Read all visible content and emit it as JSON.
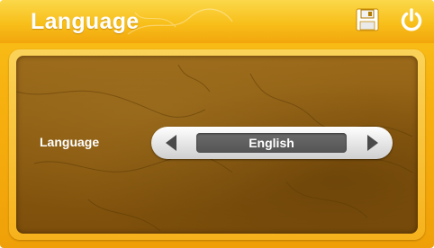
{
  "header": {
    "title": "Language",
    "save_icon": "save-icon",
    "power_icon": "power-icon"
  },
  "settings": {
    "language_label": "Language",
    "language_value": "English",
    "prev_icon": "triangle-left-icon",
    "next_icon": "triangle-right-icon"
  },
  "colors": {
    "accent": "#f7b10f",
    "panel_background": "#8a5a10",
    "selector_field": "#5e5e5e",
    "text": "#ffffff"
  }
}
